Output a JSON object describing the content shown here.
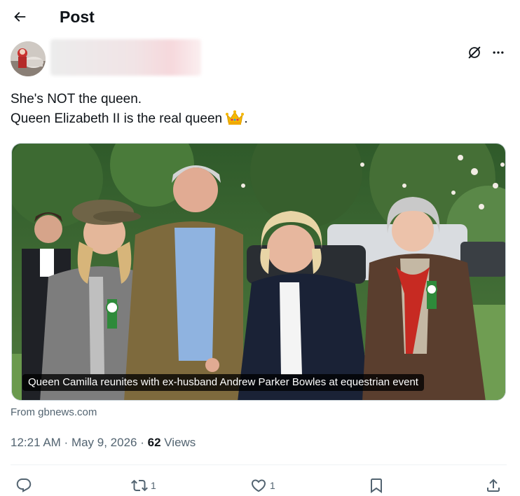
{
  "header": {
    "title": "Post"
  },
  "author": {
    "avatar_icon": "avatar-photo",
    "name_obscured": true
  },
  "post": {
    "text_line1": "She's NOT the queen.",
    "text_line2": "Queen Elizabeth II is the real queen",
    "text_line2_end": ".",
    "emoji": "crown-emoji"
  },
  "media": {
    "caption": "Queen Camilla reunites with ex-husband Andrew Parker Bowles at equestrian event"
  },
  "source": {
    "prefix": "From ",
    "domain": "gbnews.com"
  },
  "meta": {
    "time": "12:21 AM",
    "separator1": " · ",
    "date": "May 9, 2026",
    "separator2": " · ",
    "views_count": "62",
    "views_label": " Views"
  },
  "actions": {
    "reply_count": "",
    "repost_count": "1",
    "like_count": "1",
    "bookmark_count": "",
    "icons": [
      "reply-icon",
      "repost-icon",
      "like-icon",
      "bookmark-icon",
      "share-icon"
    ]
  },
  "colors": {
    "text_primary": "#0f1419",
    "text_secondary": "#536471",
    "divider": "#eff3f4"
  }
}
